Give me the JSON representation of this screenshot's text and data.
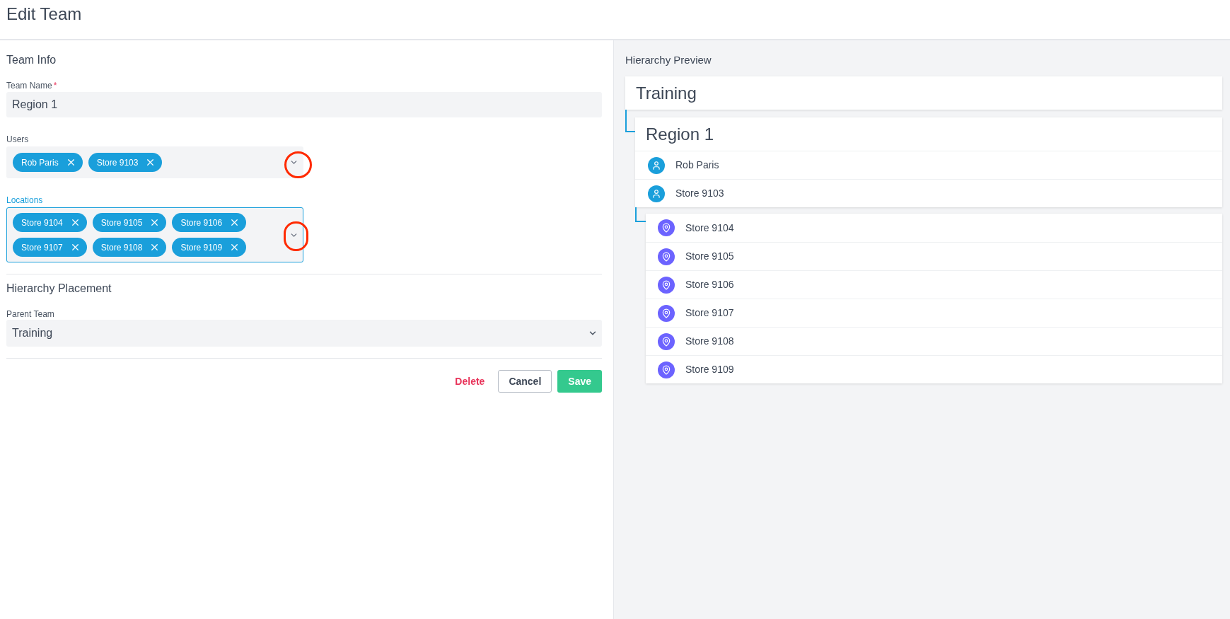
{
  "header": {
    "title": "Edit Team"
  },
  "team_info": {
    "heading": "Team Info",
    "team_name": {
      "label": "Team Name",
      "required_mark": "*",
      "value": "Region 1"
    },
    "users": {
      "label": "Users",
      "focused": false,
      "highlighted": true,
      "chips": [
        "Rob Paris",
        "Store 9103"
      ]
    },
    "locations": {
      "label": "Locations",
      "focused": true,
      "highlighted": true,
      "chips": [
        "Store 9104",
        "Store 9105",
        "Store 9106",
        "Store 9107",
        "Store 9108",
        "Store 9109"
      ]
    }
  },
  "hierarchy_placement": {
    "heading": "Hierarchy Placement",
    "parent_team": {
      "label": "Parent Team",
      "value": "Training"
    }
  },
  "actions": [
    {
      "label": "Delete",
      "kind": "danger"
    },
    {
      "label": "Cancel",
      "kind": "secondary"
    },
    {
      "label": "Save",
      "kind": "primary"
    }
  ],
  "hierarchy_preview": {
    "heading": "Hierarchy Preview",
    "parent": {
      "name": "Training"
    },
    "team": {
      "name": "Region 1",
      "members": [
        {
          "name": "Rob Paris",
          "kind": "user"
        },
        {
          "name": "Store 9103",
          "kind": "user"
        }
      ]
    },
    "locations": [
      {
        "name": "Store 9104",
        "kind": "location"
      },
      {
        "name": "Store 9105",
        "kind": "location"
      },
      {
        "name": "Store 9106",
        "kind": "location"
      },
      {
        "name": "Store 9107",
        "kind": "location"
      },
      {
        "name": "Store 9108",
        "kind": "location"
      },
      {
        "name": "Store 9109",
        "kind": "location"
      }
    ]
  }
}
